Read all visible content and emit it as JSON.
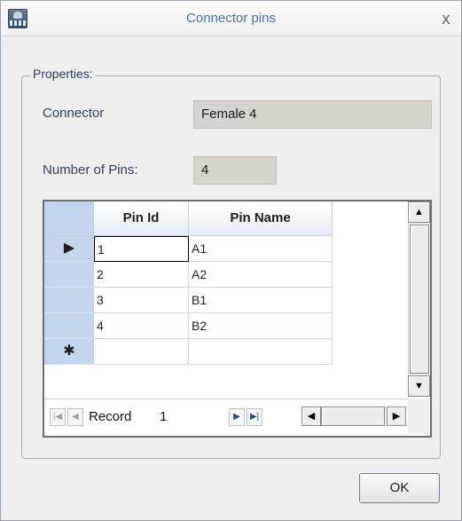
{
  "window": {
    "title": "Connector pins",
    "close_glyph": "x",
    "app_icon": "app-logo-icon"
  },
  "properties": {
    "legend": "Properties:",
    "connector_label": "Connector",
    "connector_value": "Female 4",
    "pins_label": "Number of Pins:",
    "pins_value": "4"
  },
  "grid": {
    "columns": [
      "Pin Id",
      "Pin Name"
    ],
    "rows": [
      {
        "id": "1",
        "name": "A1"
      },
      {
        "id": "2",
        "name": "A2"
      },
      {
        "id": "3",
        "name": "B1"
      },
      {
        "id": "4",
        "name": "B2"
      }
    ],
    "current_row_glyph": "▶",
    "new_row_glyph": "✱"
  },
  "navigator": {
    "record_label": "Record",
    "record_value": "1"
  },
  "buttons": {
    "ok": "OK"
  }
}
